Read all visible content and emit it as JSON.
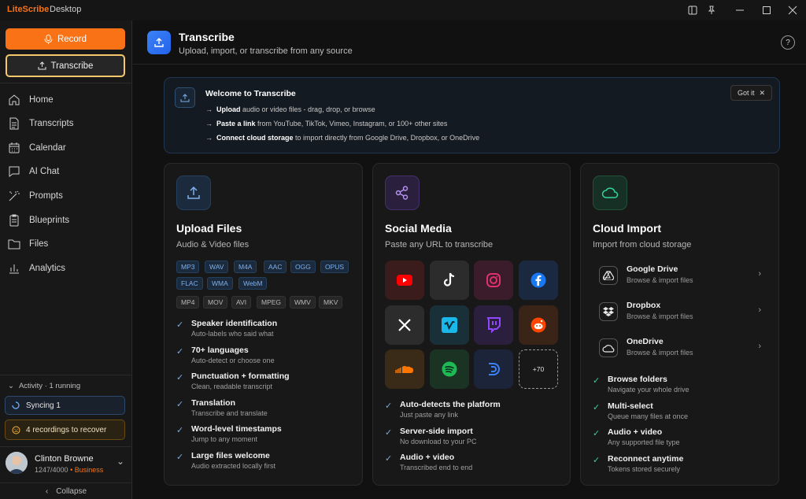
{
  "titlebar": {
    "brand": "LiteScribe",
    "subtitle": "Desktop"
  },
  "sidebar": {
    "record_label": "Record",
    "transcribe_label": "Transcribe",
    "nav": [
      {
        "label": "Home",
        "icon": "home-icon"
      },
      {
        "label": "Transcripts",
        "icon": "document-icon"
      },
      {
        "label": "Calendar",
        "icon": "calendar-icon"
      },
      {
        "label": "AI Chat",
        "icon": "chat-icon"
      },
      {
        "label": "Prompts",
        "icon": "wand-icon"
      },
      {
        "label": "Blueprints",
        "icon": "clipboard-icon"
      },
      {
        "label": "Files",
        "icon": "folder-icon"
      },
      {
        "label": "Analytics",
        "icon": "bar-chart-icon"
      }
    ],
    "activity": "Activity · 1 running",
    "syncing": "Syncing 1",
    "recover": "4 recordings to recover",
    "user": {
      "name": "Clinton Browne",
      "usage": "1247/4000",
      "separator": "•",
      "plan": "Business"
    },
    "collapse": "Collapse"
  },
  "header": {
    "title": "Transcribe",
    "subtitle": "Upload, import, or transcribe from any source"
  },
  "welcome": {
    "title": "Welcome to Transcribe",
    "lines": [
      {
        "bold": "Upload",
        "rest": " audio or video files - drag, drop, or browse"
      },
      {
        "bold": "Paste a link",
        "rest": " from YouTube, TikTok, Vimeo, Instagram, or 100+ other sites"
      },
      {
        "bold": "Connect cloud storage",
        "rest": " to import directly from Google Drive, Dropbox, or OneDrive"
      }
    ],
    "arrow": "→",
    "got_it": "Got it"
  },
  "upload": {
    "title": "Upload Files",
    "subtitle": "Audio & Video files",
    "audio_formats": [
      "MP3",
      "WAV",
      "M4A",
      "AAC",
      "OGG",
      "OPUS",
      "FLAC",
      "WMA",
      "WebM"
    ],
    "video_formats": [
      "MP4",
      "MOV",
      "AVI",
      "MPEG",
      "WMV",
      "MKV"
    ],
    "features": [
      {
        "title": "Speaker identification",
        "sub": "Auto-labels who said what"
      },
      {
        "title": "70+ languages",
        "sub": "Auto-detect or choose one"
      },
      {
        "title": "Punctuation + formatting",
        "sub": "Clean, readable transcript"
      },
      {
        "title": "Translation",
        "sub": "Transcribe and translate"
      },
      {
        "title": "Word-level timestamps",
        "sub": "Jump to any moment"
      },
      {
        "title": "Large files welcome",
        "sub": "Audio extracted locally first"
      }
    ]
  },
  "social": {
    "title": "Social Media",
    "subtitle": "Paste any URL to transcribe",
    "platforms": [
      "youtube-icon",
      "tiktok-icon",
      "instagram-icon",
      "facebook-icon",
      "x-icon",
      "vimeo-icon",
      "twitch-icon",
      "reddit-icon",
      "soundcloud-icon",
      "spotify-icon",
      "dailymotion-icon"
    ],
    "more": "+70",
    "features": [
      {
        "title": "Auto-detects the platform",
        "sub": "Just paste any link"
      },
      {
        "title": "Server-side import",
        "sub": "No download to your PC"
      },
      {
        "title": "Audio + video",
        "sub": "Transcribed end to end"
      }
    ]
  },
  "cloud": {
    "title": "Cloud Import",
    "subtitle": "Import from cloud storage",
    "providers": [
      {
        "name": "Google Drive",
        "sub": "Browse & import files"
      },
      {
        "name": "Dropbox",
        "sub": "Browse & import files"
      },
      {
        "name": "OneDrive",
        "sub": "Browse & import files"
      }
    ],
    "features": [
      {
        "title": "Browse folders",
        "sub": "Navigate your whole drive"
      },
      {
        "title": "Multi-select",
        "sub": "Queue many files at once"
      },
      {
        "title": "Audio + video",
        "sub": "Any supported file type"
      },
      {
        "title": "Reconnect anytime",
        "sub": "Tokens stored securely"
      }
    ]
  },
  "colors": {
    "accent": "#f97316",
    "blue": "#3b82f6",
    "green": "#22c55e"
  }
}
